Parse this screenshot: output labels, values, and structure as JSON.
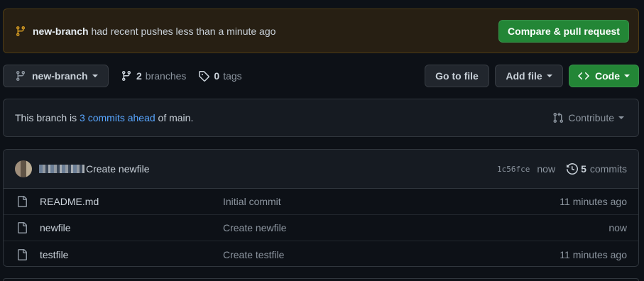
{
  "banner": {
    "branch": "new-branch",
    "message": "had recent pushes less than a minute ago",
    "compare_label": "Compare & pull request"
  },
  "toolbar": {
    "branch_label": "new-branch",
    "branches_count": "2",
    "branches_label": "branches",
    "tags_count": "0",
    "tags_label": "tags",
    "goto_label": "Go to file",
    "addfile_label": "Add file",
    "code_label": "Code"
  },
  "ahead": {
    "prefix": "This branch is",
    "link": "3 commits ahead",
    "suffix": "of main.",
    "contribute_label": "Contribute"
  },
  "latest_commit": {
    "message": "Create newfile",
    "sha": "1c56fce",
    "ago": "now",
    "commits_count": "5",
    "commits_label": "commits"
  },
  "files": [
    {
      "name": "README.md",
      "commit": "Initial commit",
      "age": "11 minutes ago"
    },
    {
      "name": "newfile",
      "commit": "Create newfile",
      "age": "now"
    },
    {
      "name": "testfile",
      "commit": "Create testfile",
      "age": "11 minutes ago"
    }
  ],
  "colors": {
    "accent_green": "#238636",
    "link_blue": "#58a6ff",
    "banner_bg": "#271f13",
    "branch_icon": "#d29922"
  }
}
